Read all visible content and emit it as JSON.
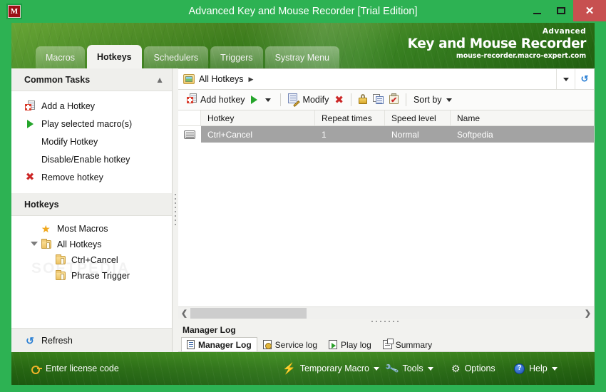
{
  "window": {
    "title": "Advanced Key and Mouse Recorder [Trial Edition]",
    "icon": "app-logo-m",
    "logo_letter": "M",
    "minimize_label": "",
    "maximize_label": "",
    "close_label": "✕",
    "accent_green": "#2db253",
    "close_red": "#c75050"
  },
  "banner": {
    "brand_small": "Advanced",
    "brand_big": "Key and Mouse Recorder",
    "brand_url": "mouse-recorder.macro-expert.com"
  },
  "tabs": [
    {
      "label": "Macros",
      "active": false
    },
    {
      "label": "Hotkeys",
      "active": true
    },
    {
      "label": "Schedulers",
      "active": false
    },
    {
      "label": "Triggers",
      "active": false
    },
    {
      "label": "Systray Menu",
      "active": false
    }
  ],
  "sidebar": {
    "common_tasks": {
      "title": "Common Tasks",
      "collapse_icon": "chevron-up-double-icon",
      "items": [
        {
          "label": "Add a Hotkey",
          "icon": "add-page-icon"
        },
        {
          "label": "Play selected macro(s)",
          "icon": "play-green-icon"
        },
        {
          "label": "Modify Hotkey",
          "icon": "none"
        },
        {
          "label": "Disable/Enable hotkey",
          "icon": "none"
        },
        {
          "label": "Remove hotkey",
          "icon": "remove-x-icon"
        }
      ]
    },
    "hotkeys_section": {
      "title": "Hotkeys",
      "tree": [
        {
          "label": "Most Macros",
          "icon": "star-icon",
          "level": 0,
          "expander": false
        },
        {
          "label": "All Hotkeys",
          "icon": "folder-icon",
          "level": 0,
          "expander": true
        },
        {
          "label": "Ctrl+Cancel",
          "icon": "folder-doc-icon",
          "level": 1,
          "expander": false
        },
        {
          "label": "Phrase Trigger",
          "icon": "folder-doc-icon",
          "level": 1,
          "expander": false
        }
      ],
      "watermark": "SOFTPEDIA"
    },
    "refresh": {
      "label": "Refresh",
      "icon": "refresh-icon"
    }
  },
  "main": {
    "breadcrumb": {
      "folder_icon": "folder-image-icon",
      "path": "All Hotkeys",
      "separator": "▶",
      "dropdown_icon": "chevron-down-icon",
      "refresh_icon": "refresh-icon"
    },
    "toolbar": {
      "add_label": "Add hotkey",
      "add_icon": "add-page-icon",
      "play_icon": "play-green-icon",
      "play_dropdown_icon": "chevron-down-icon",
      "modify_label": "Modify",
      "modify_icon": "modify-pencil-icon",
      "delete_icon": "delete-x-icon",
      "lock_icon": "lock-icon",
      "copy_icon": "copy-icon",
      "clipboard_icon": "clipboard-check-icon",
      "sort_label": "Sort by",
      "sort_dropdown_icon": "chevron-down-icon"
    },
    "list": {
      "columns": [
        {
          "label": "Hotkey",
          "width": 160
        },
        {
          "label": "Repeat times",
          "width": 98
        },
        {
          "label": "Speed level",
          "width": 92
        },
        {
          "label": "Name",
          "width": 190
        }
      ],
      "rows": [
        {
          "icon": "keyboard-icon",
          "hotkey": "Ctrl+Cancel",
          "repeat_times": "1",
          "speed_level": "Normal",
          "name": "Softpedia",
          "selected": true
        }
      ]
    },
    "scrollbar": {
      "left_arrow": "❮",
      "right_arrow": "❯"
    },
    "log": {
      "title": "Manager Log",
      "tabs": [
        {
          "label": "Manager Log",
          "icon": "document-icon",
          "active": true
        },
        {
          "label": "Service log",
          "icon": "service-doc-icon",
          "active": false
        },
        {
          "label": "Play log",
          "icon": "play-doc-icon",
          "active": false
        },
        {
          "label": "Summary",
          "icon": "summary-doc-icon",
          "active": false
        }
      ]
    }
  },
  "statusbar": {
    "license": {
      "label": "Enter license code",
      "icon": "key-icon"
    },
    "items": [
      {
        "label": "Temporary Macro",
        "icon": "bolt-icon",
        "dropdown": true
      },
      {
        "label": "Tools",
        "icon": "wrench-icon",
        "dropdown": true
      },
      {
        "label": "Options",
        "icon": "gears-icon",
        "dropdown": false
      },
      {
        "label": "Help",
        "icon": "help-circle-icon",
        "dropdown": true
      }
    ]
  }
}
